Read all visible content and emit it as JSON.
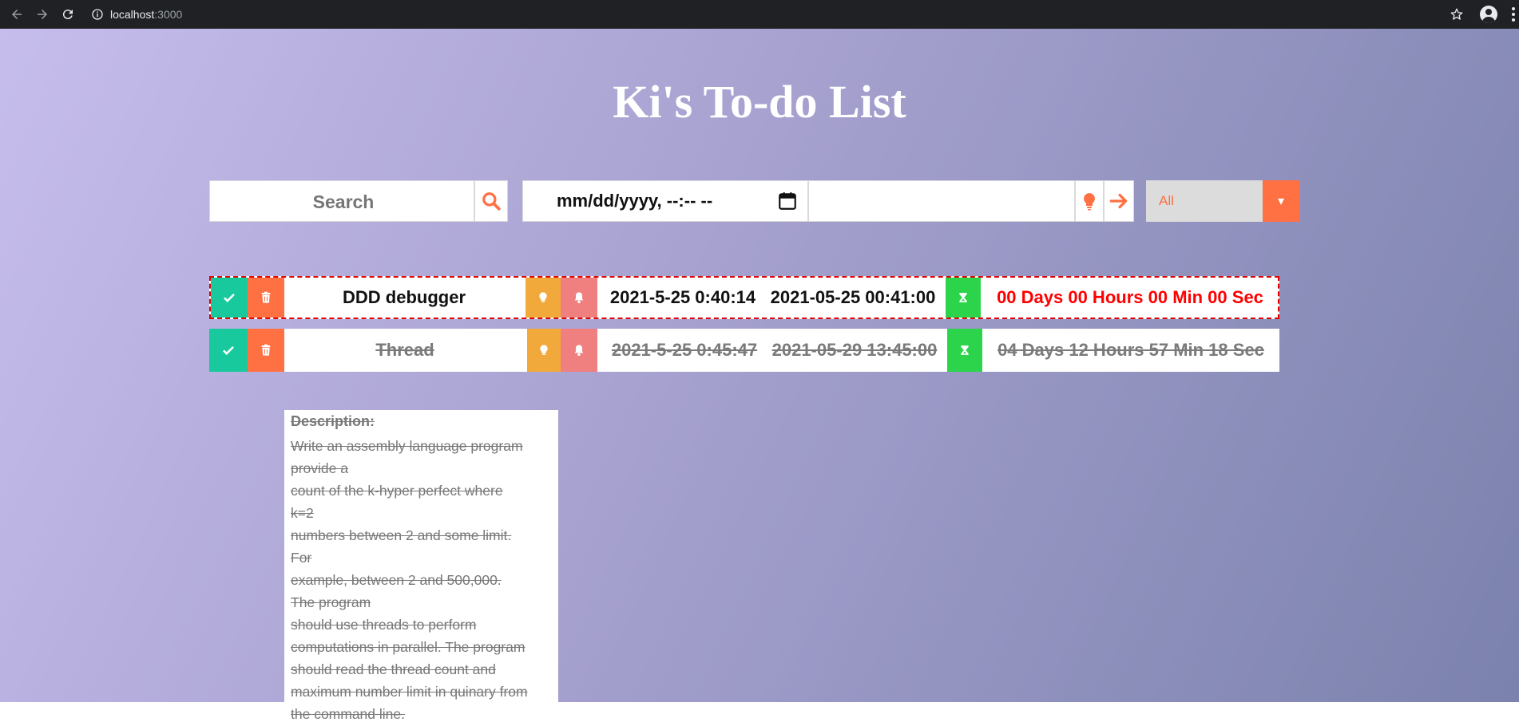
{
  "browser": {
    "url_host": "localhost",
    "url_port": ":3000"
  },
  "app": {
    "title": "Ki's To-do List"
  },
  "toolbar": {
    "search_placeholder": "Search",
    "date_value": "mm/dd/yyyy, --:-- --",
    "task_value": "",
    "filter_selected": "All",
    "filter_arrow": "▾"
  },
  "todos": [
    {
      "name": "DDD debugger",
      "created": "2021-5-25 0:40:14",
      "due": "2021-05-25 00:41:00",
      "time_left": "00 Days 00 Hours 00 Min 00 Sec",
      "completed": false,
      "overdue": true
    },
    {
      "name": "Thread",
      "created": "2021-5-25 0:45:47",
      "due": "2021-05-29 13:45:00",
      "time_left": "04 Days 12 Hours 57 Min 18 Sec",
      "completed": true,
      "overdue": false
    }
  ],
  "description": {
    "heading": "Description:",
    "lines": [
      "Write an assembly language program",
      "provide a",
      "count of the k-hyper perfect where",
      "k=2",
      "numbers between 2 and some limit.",
      "For",
      "example, between 2 and 500,000.",
      "The program",
      "should use threads to perform",
      "computations in parallel. The program",
      "should read the thread count and",
      "maximum number limit in quinary from",
      "the command line."
    ]
  },
  "colors": {
    "check": "#17c99c",
    "trash": "#ff7043",
    "idea": "#f2a93b",
    "bell": "#f08080",
    "timer": "#2bd44a",
    "overdue_text": "#ff0000",
    "accent": "#ff7043"
  }
}
